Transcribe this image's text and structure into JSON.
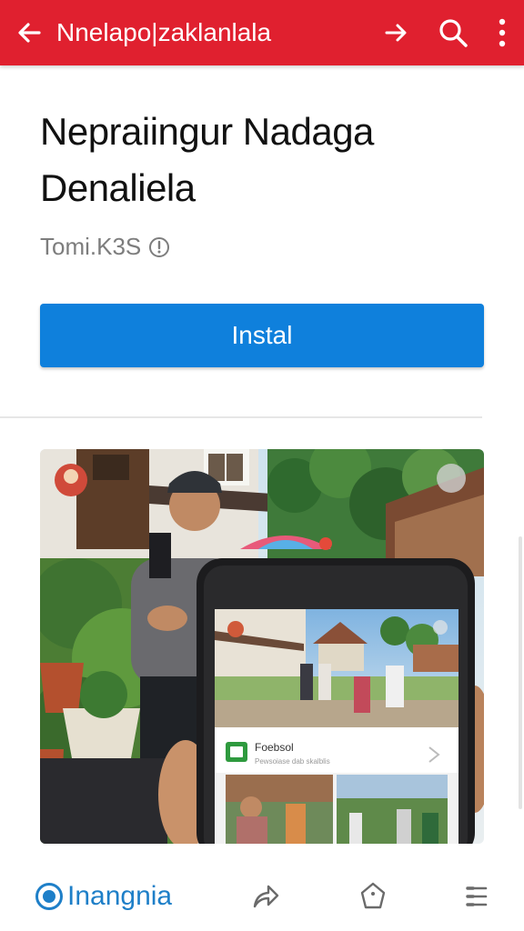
{
  "appbar": {
    "title": "Nnelapo|zaklanlala",
    "back_icon": "arrow-left-icon",
    "share_icon": "share-arrow-icon",
    "search_icon": "search-icon",
    "menu_icon": "more-vert-icon",
    "color": "#e0202f"
  },
  "app": {
    "title_line1": "Nepraiingur Nadaga",
    "title_line2": "Denaliela",
    "developer": "Tomi.K3S",
    "developer_icon": "info-icon",
    "install_label": "Instal",
    "install_color": "#0f80dc"
  },
  "preview": {
    "phone_card_title": "Foebsol",
    "phone_card_subtitle": "Pewsoiase dab skalblis"
  },
  "bottom_nav": {
    "brand": "Inangnia",
    "brand_icon": "brand-circle-icon",
    "share_icon": "share-icon",
    "tag_icon": "tag-icon",
    "menu_icon": "menu-lines-icon",
    "brand_color": "#1e7fc8"
  }
}
